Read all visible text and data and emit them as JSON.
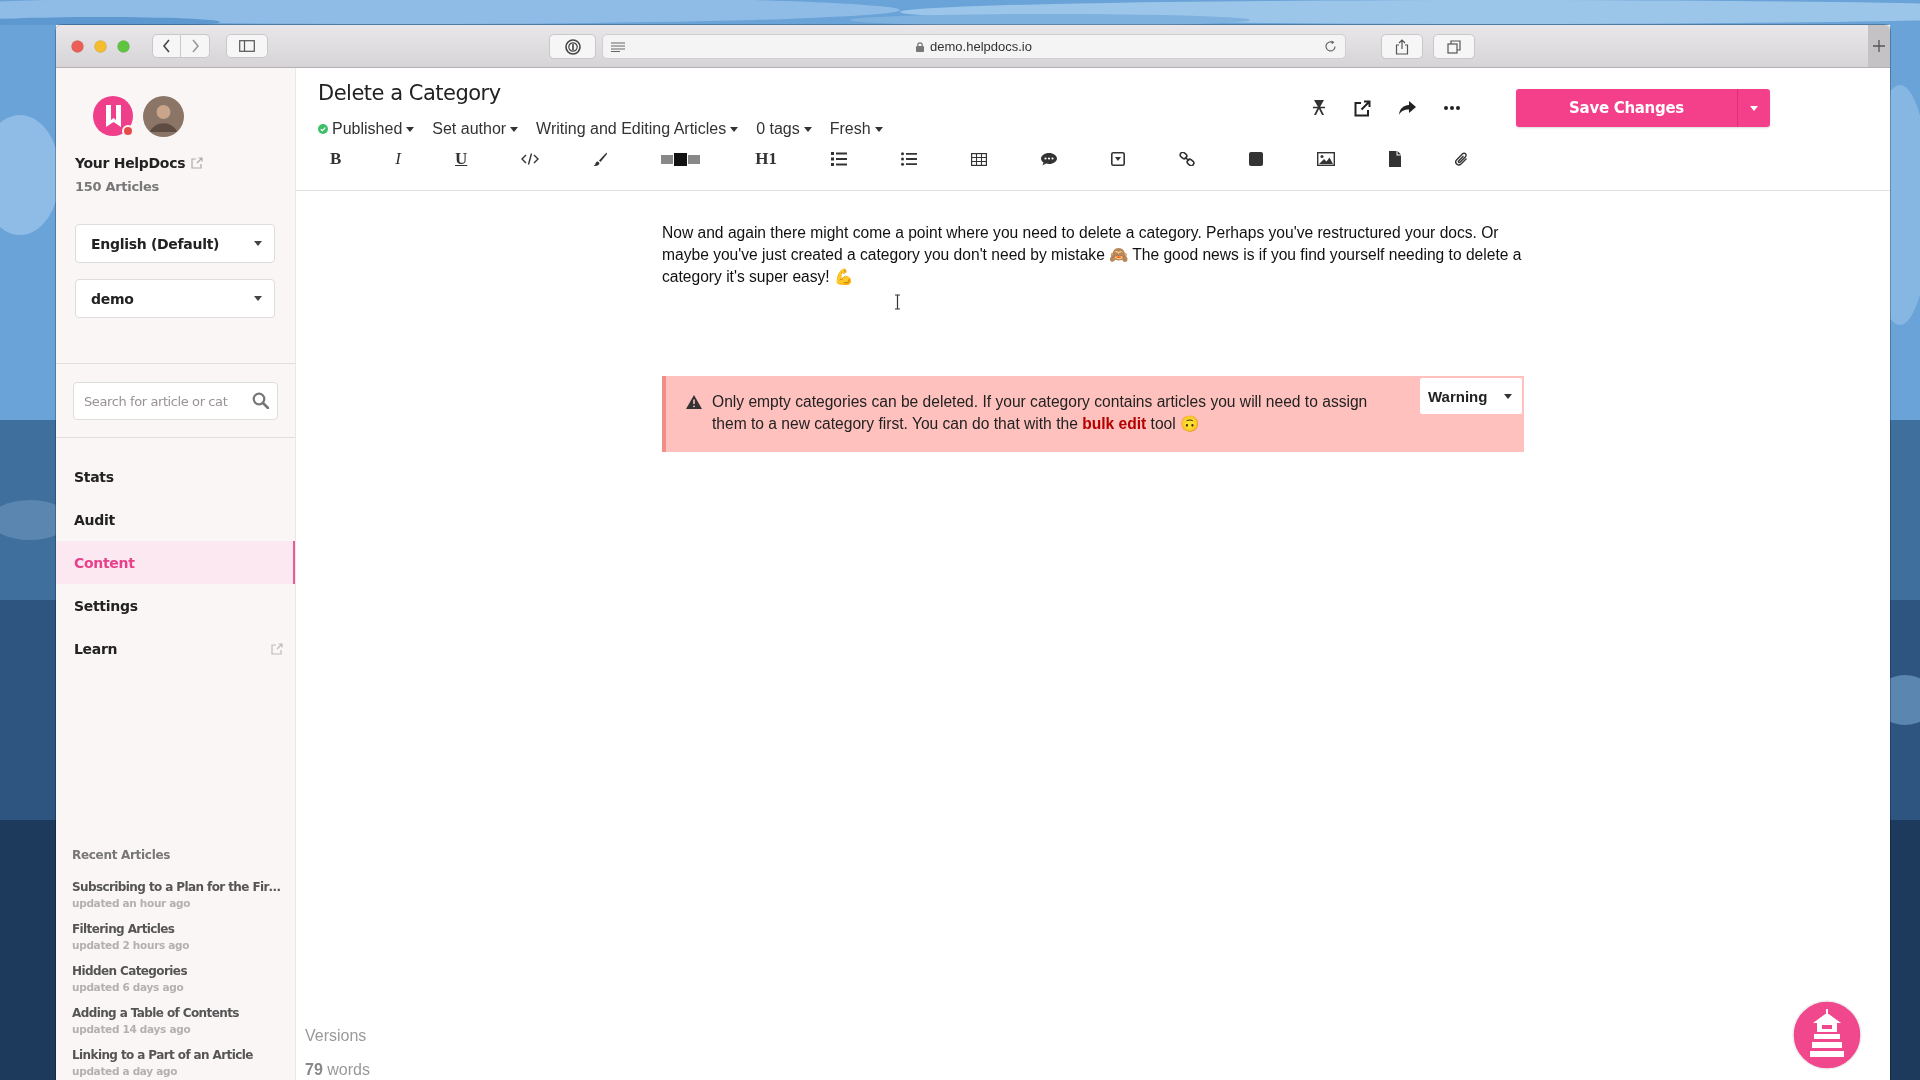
{
  "browser": {
    "url": "demo.helpdocs.io"
  },
  "sidebar": {
    "brand": {
      "name": "Your HelpDocs",
      "count": "150 Articles"
    },
    "selects": [
      {
        "value": "English (Default)"
      },
      {
        "value": "demo"
      }
    ],
    "search": {
      "placeholder": "Search for article or cat"
    },
    "nav": [
      {
        "label": "Stats",
        "selected": false,
        "external": false
      },
      {
        "label": "Audit",
        "selected": false,
        "external": false
      },
      {
        "label": "Content",
        "selected": true,
        "external": false
      },
      {
        "label": "Settings",
        "selected": false,
        "external": false
      },
      {
        "label": "Learn",
        "selected": false,
        "external": true
      }
    ],
    "recent": {
      "title": "Recent Articles",
      "items": [
        {
          "title": "Subscribing to a Plan for the Fir…",
          "updated": "updated an hour ago"
        },
        {
          "title": "Filtering Articles",
          "updated": "updated 2 hours ago"
        },
        {
          "title": "Hidden Categories",
          "updated": "updated 6 days ago"
        },
        {
          "title": "Adding a Table of Contents",
          "updated": "updated 14 days ago"
        },
        {
          "title": "Linking to a Part of an Article",
          "updated": "updated a day ago"
        }
      ]
    }
  },
  "editor": {
    "title": "Delete a Category",
    "meta": [
      {
        "kind": "status",
        "label": "Published"
      },
      {
        "kind": "menu",
        "label": "Set author"
      },
      {
        "kind": "menu",
        "label": "Writing and Editing Articles"
      },
      {
        "kind": "menu",
        "label": "0 tags"
      },
      {
        "kind": "menu",
        "label": "Fresh"
      }
    ],
    "toolbar": [
      {
        "kind": "bold",
        "label": "B"
      },
      {
        "kind": "italic",
        "label": "I"
      },
      {
        "kind": "underline",
        "label": "U"
      },
      {
        "kind": "icon"
      },
      {
        "kind": "icon"
      },
      {
        "kind": "icon"
      },
      {
        "kind": "heading",
        "label": "H1"
      },
      {
        "kind": "icon"
      },
      {
        "kind": "icon"
      },
      {
        "kind": "icon"
      },
      {
        "kind": "icon"
      },
      {
        "kind": "icon"
      },
      {
        "kind": "icon"
      },
      {
        "kind": "icon"
      },
      {
        "kind": "icon"
      },
      {
        "kind": "icon"
      },
      {
        "kind": "icon"
      }
    ],
    "save": {
      "label": "Save Changes"
    },
    "body": "Now and again there might come a point where you need to delete a category. Perhaps you've restructured your docs. Or maybe you've just created a category you don't need by mistake 🙈 The good news is if you find yourself needing to delete a category it's super easy! 💪",
    "callout": {
      "text": "Only empty categories can be deleted. If your category contains articles you will need to assign them to a new category first. You can do that with the **bulk edit** tool 🙃",
      "type": "Warning"
    },
    "versions": "Versions",
    "words": "**79** words"
  }
}
